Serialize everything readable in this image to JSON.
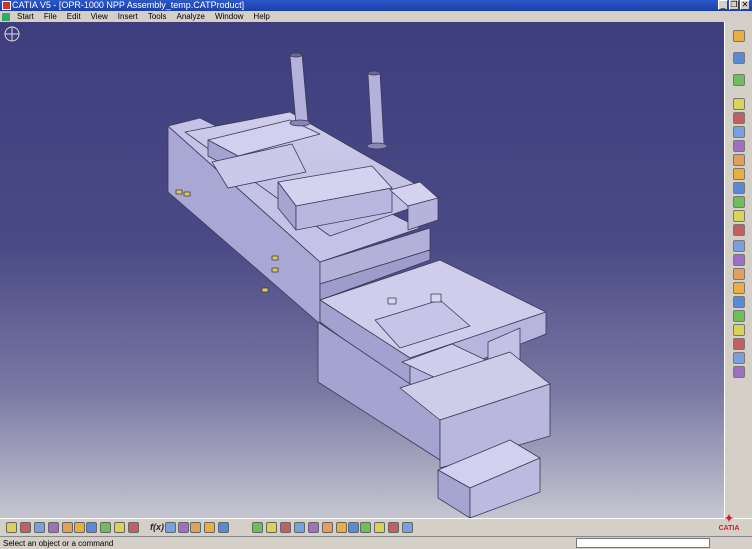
{
  "window": {
    "title": "CATIA V5 - [OPR-1000 NPP Assembly_temp.CATProduct]",
    "controls": {
      "minimize": "_",
      "restore": "❐",
      "close": "✕"
    }
  },
  "menu": {
    "items": [
      "Start",
      "File",
      "Edit",
      "View",
      "Insert",
      "Tools",
      "Analyze",
      "Window",
      "Help"
    ]
  },
  "viewport": {
    "model_color": "#b7b5e0",
    "background_top": "#3e3e7e",
    "background_bottom": "#c6c6d2",
    "compass_icon": "compass-icon"
  },
  "right_toolbar": {
    "icons": [
      "sketch-icon",
      "select-icon",
      "constraint-icon",
      "product-icon",
      "component-icon",
      "part-icon",
      "existing-component-icon",
      "replace-icon",
      "graph-tree-icon",
      "renumber-icon",
      "multi-instantiate-icon",
      "fast-multi-instantiate-icon",
      "manipulation-icon",
      "snap-icon",
      "explode-icon",
      "stop-manipulate-icon",
      "scenes-icon",
      "clash-icon",
      "sectioning-icon",
      "distance-icon",
      "annotation-icon",
      "light-icon",
      "catalog-icon"
    ]
  },
  "bottom_toolbar": {
    "formula_label": "f(x)",
    "icons": [
      "new-icon",
      "open-icon",
      "save-icon",
      "print-icon",
      "cut-icon",
      "copy-icon",
      "paste-icon",
      "undo-icon",
      "redo-icon",
      "whats-this-icon",
      "formula-icon",
      "knowledge-icon",
      "hide-show-icon",
      "swap-icon",
      "properties-icon",
      "fly-icon",
      "fit-all-icon",
      "pan-icon",
      "rotate-icon",
      "zoom-in-icon",
      "zoom-out-icon",
      "normal-view-icon",
      "iso-view-icon",
      "shading-icon",
      "hide-icon",
      "swap-visible-icon",
      "render-icon"
    ]
  },
  "status": {
    "message": "Select an object or a command",
    "command_input": ""
  },
  "logo": {
    "text": "CATIA"
  }
}
